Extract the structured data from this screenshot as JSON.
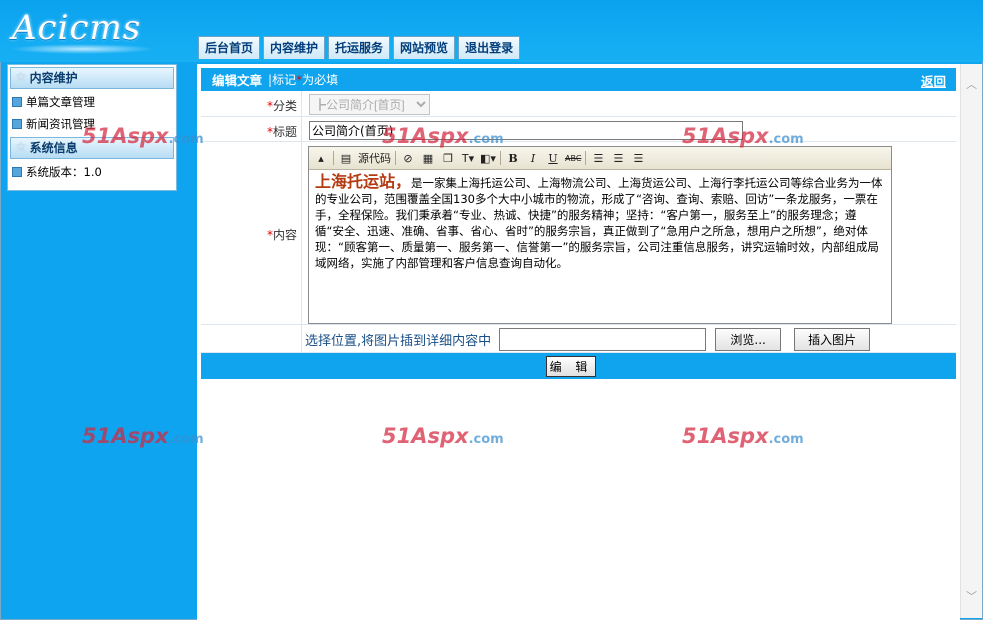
{
  "app": {
    "logo_text": "Acicms"
  },
  "nav": {
    "tabs": [
      "后台首页",
      "内容维护",
      "托运服务",
      "网站预览",
      "退出登录"
    ]
  },
  "sidebar": {
    "section1": {
      "title": "内容维护",
      "items": [
        "单篇文章管理",
        "新闻资讯管理"
      ]
    },
    "section2": {
      "title": "系统信息",
      "items": [
        "系统版本：1.0"
      ]
    }
  },
  "form": {
    "header_title": "编辑文章",
    "header_note_pre": "标记",
    "header_note_star": "*",
    "header_note_post": "为必填",
    "back_label": "返回",
    "category_label": "分类",
    "category_value": "┣公司简介[首页]",
    "title_label": "标题",
    "title_value": "公司简介(首页)",
    "content_label": "内容",
    "required_mark": "*",
    "upload_label": "选择位置,将图片插到详细内容中",
    "browse_label": "浏览...",
    "insert_label": "插入图片",
    "submit_label": "编 辑"
  },
  "editor": {
    "toolbar": {
      "source_label": "源代码",
      "bold": "B",
      "italic": "I",
      "underline": "U",
      "strike": "ABC"
    },
    "content_lead": "上海托运站，",
    "content_body": "是一家集上海托运公司、上海物流公司、上海货运公司、上海行李托运公司等综合业务为一体的专业公司，范围覆盖全国130多个大中小城市的物流，形成了“咨询、查询、索赔、回访”一条龙服务，一票在手，全程保险。我们秉承着“专业、热诚、快捷”的服务精神；坚持：“客户第一，服务至上”的服务理念；遵循“安全、迅速、准确、省事、省心、省时”的服务宗旨，真正做到了“急用户之所急，想用户之所想”，绝对体现：“顾客第一、质量第一、服务第一、信誉第一”的服务宗旨，公司注重信息服务，讲究运输时效，内部组成局域网络，实施了内部管理和客户信息查询自动化。"
  },
  "watermark": {
    "brand": "51Aspx",
    "suffix": ".com"
  },
  "colors": {
    "accent": "#10a4ee",
    "required": "#e60000",
    "lead_text": "#b43a12"
  }
}
